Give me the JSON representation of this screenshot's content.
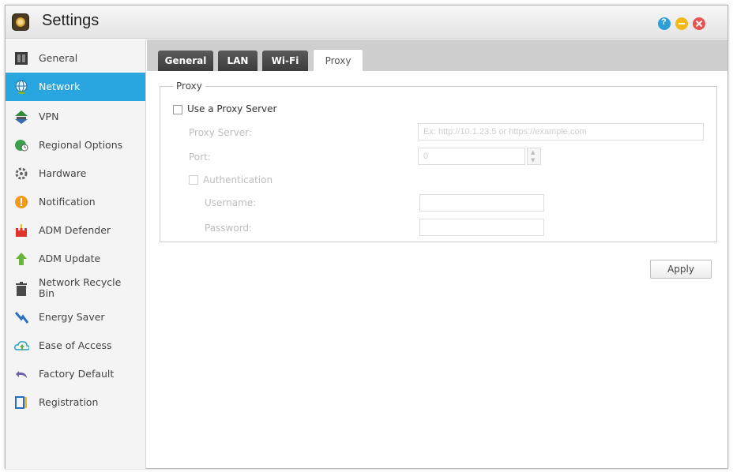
{
  "window": {
    "title": "Settings"
  },
  "sidebar": {
    "items": [
      {
        "label": "General",
        "icon": "general-icon"
      },
      {
        "label": "Network",
        "icon": "globe-icon"
      },
      {
        "label": "VPN",
        "icon": "vpn-icon"
      },
      {
        "label": "Regional Options",
        "icon": "regional-icon"
      },
      {
        "label": "Hardware",
        "icon": "hardware-icon"
      },
      {
        "label": "Notification",
        "icon": "notification-icon"
      },
      {
        "label": "ADM Defender",
        "icon": "defender-icon"
      },
      {
        "label": "ADM Update",
        "icon": "update-icon"
      },
      {
        "label": "Network Recycle Bin",
        "icon": "recycle-bin-icon"
      },
      {
        "label": "Energy Saver",
        "icon": "energy-icon"
      },
      {
        "label": "Ease of Access",
        "icon": "cloud-icon"
      },
      {
        "label": "Factory Default",
        "icon": "undo-icon"
      },
      {
        "label": "Registration",
        "icon": "registration-icon"
      }
    ],
    "active": "Network"
  },
  "tabs": [
    {
      "label": "General"
    },
    {
      "label": "LAN"
    },
    {
      "label": "Wi-Fi"
    },
    {
      "label": "Proxy"
    }
  ],
  "active_tab": "Proxy",
  "proxy": {
    "legend": "Proxy",
    "use_proxy_label": "Use a Proxy Server",
    "use_proxy_checked": false,
    "server_label": "Proxy Server:",
    "server_placeholder": "Ex: http://10.1.23.5 or https://example.com",
    "port_label": "Port:",
    "port_value": "0",
    "auth_label": "Authentication",
    "auth_checked": false,
    "username_label": "Username:",
    "username_value": "",
    "password_label": "Password:",
    "password_value": ""
  },
  "apply_label": "Apply",
  "colors": {
    "active_blue": "#29a6e0",
    "tab_dark": "#3c3c3c",
    "help": "#2d9fd8",
    "minimize": "#f2b81c",
    "close": "#e8524f"
  }
}
